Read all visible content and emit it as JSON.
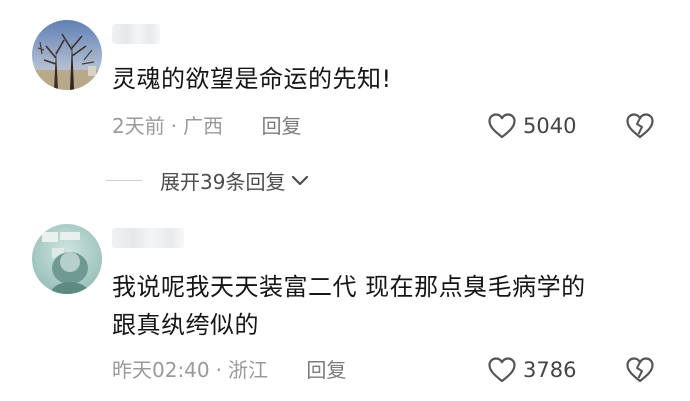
{
  "comments": [
    {
      "text": "灵魂的欲望是命运的先知!",
      "time": "2天前",
      "separator": "·",
      "location": "广西",
      "reply_label": "回复",
      "likes": "5040"
    },
    {
      "text_line1": "我说呢我天天装富二代 现在那点臭毛病学的",
      "text_line2": "跟真纨绔似的",
      "time": "昨天02:40",
      "separator": "·",
      "location": "浙江",
      "reply_label": "回复",
      "likes": "3786"
    }
  ],
  "expand_replies": {
    "label": "展开39条回复"
  },
  "icons": {
    "like": "heart-outline-icon",
    "dislike": "broken-heart-icon",
    "expand": "chevron-down-icon"
  },
  "colors": {
    "text": "#161616",
    "meta": "#9a9a9a",
    "icon": "#555555"
  }
}
